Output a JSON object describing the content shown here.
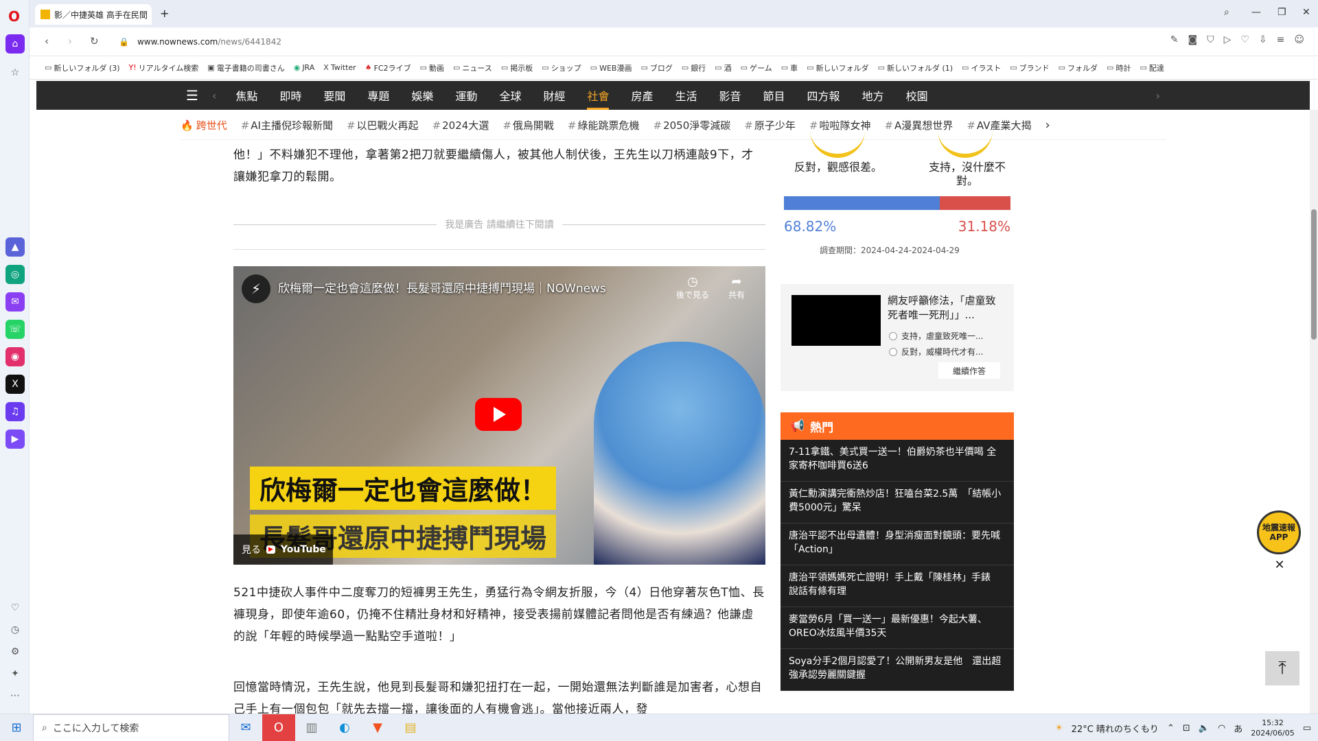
{
  "browser": {
    "tab_title": "影／中捷英雄 高手在民間",
    "url_host": "www.nownews.com",
    "url_path": "/news/6441842"
  },
  "bookmarks": [
    "新しいフォルダ (3)",
    "リアルタイム検索",
    "電子書籍の司書さん",
    "JRA",
    "Twitter",
    "FC2ライブ",
    "動画",
    "ニュース",
    "掲示板",
    "ショップ",
    "WEB漫画",
    "ブログ",
    "銀行",
    "酒",
    "ゲーム",
    "車",
    "新しいフォルダ",
    "新しいフォルダ (1)",
    "イラスト",
    "ブランド",
    "フォルダ",
    "時計",
    "配達"
  ],
  "site_nav": {
    "items": [
      "焦點",
      "即時",
      "要聞",
      "專題",
      "娛樂",
      "運動",
      "全球",
      "財經",
      "社會",
      "房產",
      "生活",
      "影音",
      "節目",
      "四方報",
      "地方",
      "校園"
    ],
    "active": "社會"
  },
  "tags": {
    "hot_label": "跨世代",
    "items": [
      "AI主播倪珍報新聞",
      "以巴戰火再起",
      "2024大選",
      "俄烏開戰",
      "綠能跳票危機",
      "2050淨零減碳",
      "原子少年",
      "啦啦隊女神",
      "A漫異想世界",
      "AV產業大揭"
    ]
  },
  "article": {
    "para_top": "他！」不料嫌犯不理他，拿著第2把刀就要繼續傷人，被其他人制伏後，王先生以刀柄連敲9下，才讓嫌犯拿刀的鬆開。",
    "ad_notice": "我是廣告 請繼續往下閱讀",
    "para_mid": "521中捷砍人事件中二度奪刀的短褲男王先生，勇猛行為令網友折服，今（4）日他穿著灰色T恤、長褲現身，即使年逾60，仍掩不住精壯身材和好精神，接受表揚前媒體記者問他是否有練過？他謙虛的說「年輕的時候學過一點點空手道啦！」",
    "para_bottom": "回憶當時情況，王先生說，他見到長髮哥和嫌犯扭打在一起，一開始還無法判斷誰是加害者，心想自己手上有一個包包「就先去擋一擋，讓後面的人有機會逃」。當他接近兩人，發"
  },
  "video": {
    "title": "欣梅爾一定也會這麼做！長髮哥還原中捷搏鬥現場｜NOWnews",
    "watch_later": "後で見る",
    "share": "共有",
    "caption1": "欣梅爾一定也會這麼做！",
    "caption2": "長髮哥還原中捷搏鬥現場",
    "watch_on": "見る",
    "youtube": "YouTube"
  },
  "poll_top": {
    "option_left": "反對，觀感很差。",
    "option_right": "支持，沒什麼不對。",
    "pct_left": "68.82%",
    "pct_right": "31.18%",
    "period": "調查期間：2024-04-24-2024-04-29",
    "ratio_left": 0.6882
  },
  "poll_2": {
    "question": "網友呼籲修法，「虐童致死者唯一死刑」」...",
    "option1": "支持，虐童致死唯一...",
    "option2": "反對，威權時代才有...",
    "button": "繼續作答"
  },
  "hot": {
    "title": "熱門",
    "items": [
      "7-11拿鐵、美式買一送一！伯爵奶茶也半價喝 全家寄杯咖啡買6送6",
      "黃仁勳演講完衝熱炒店！狂嗑台菜2.5萬　「結帳小費5000元」驚呆",
      "唐治平認不出母遺體！身型消瘦面對鏡頭：要先喊「Action」",
      "唐治平領媽媽死亡證明！手上戴「陳桂林」手錶　說話有條有理",
      "麥當勞6月「買一送一」最新優惠！今起大薯、OREO冰炫風半價35天",
      "Soya分手2個月認愛了！公開新男友是他　還出超強承認勞麗關鍵握"
    ]
  },
  "floating": {
    "quake_label": "地震速報APP"
  },
  "taskbar": {
    "search_placeholder": "ここに入力して検索",
    "weather": "22°C 晴れのちくもり",
    "time": "15:32",
    "date": "2024/06/05",
    "ime": "あ"
  }
}
